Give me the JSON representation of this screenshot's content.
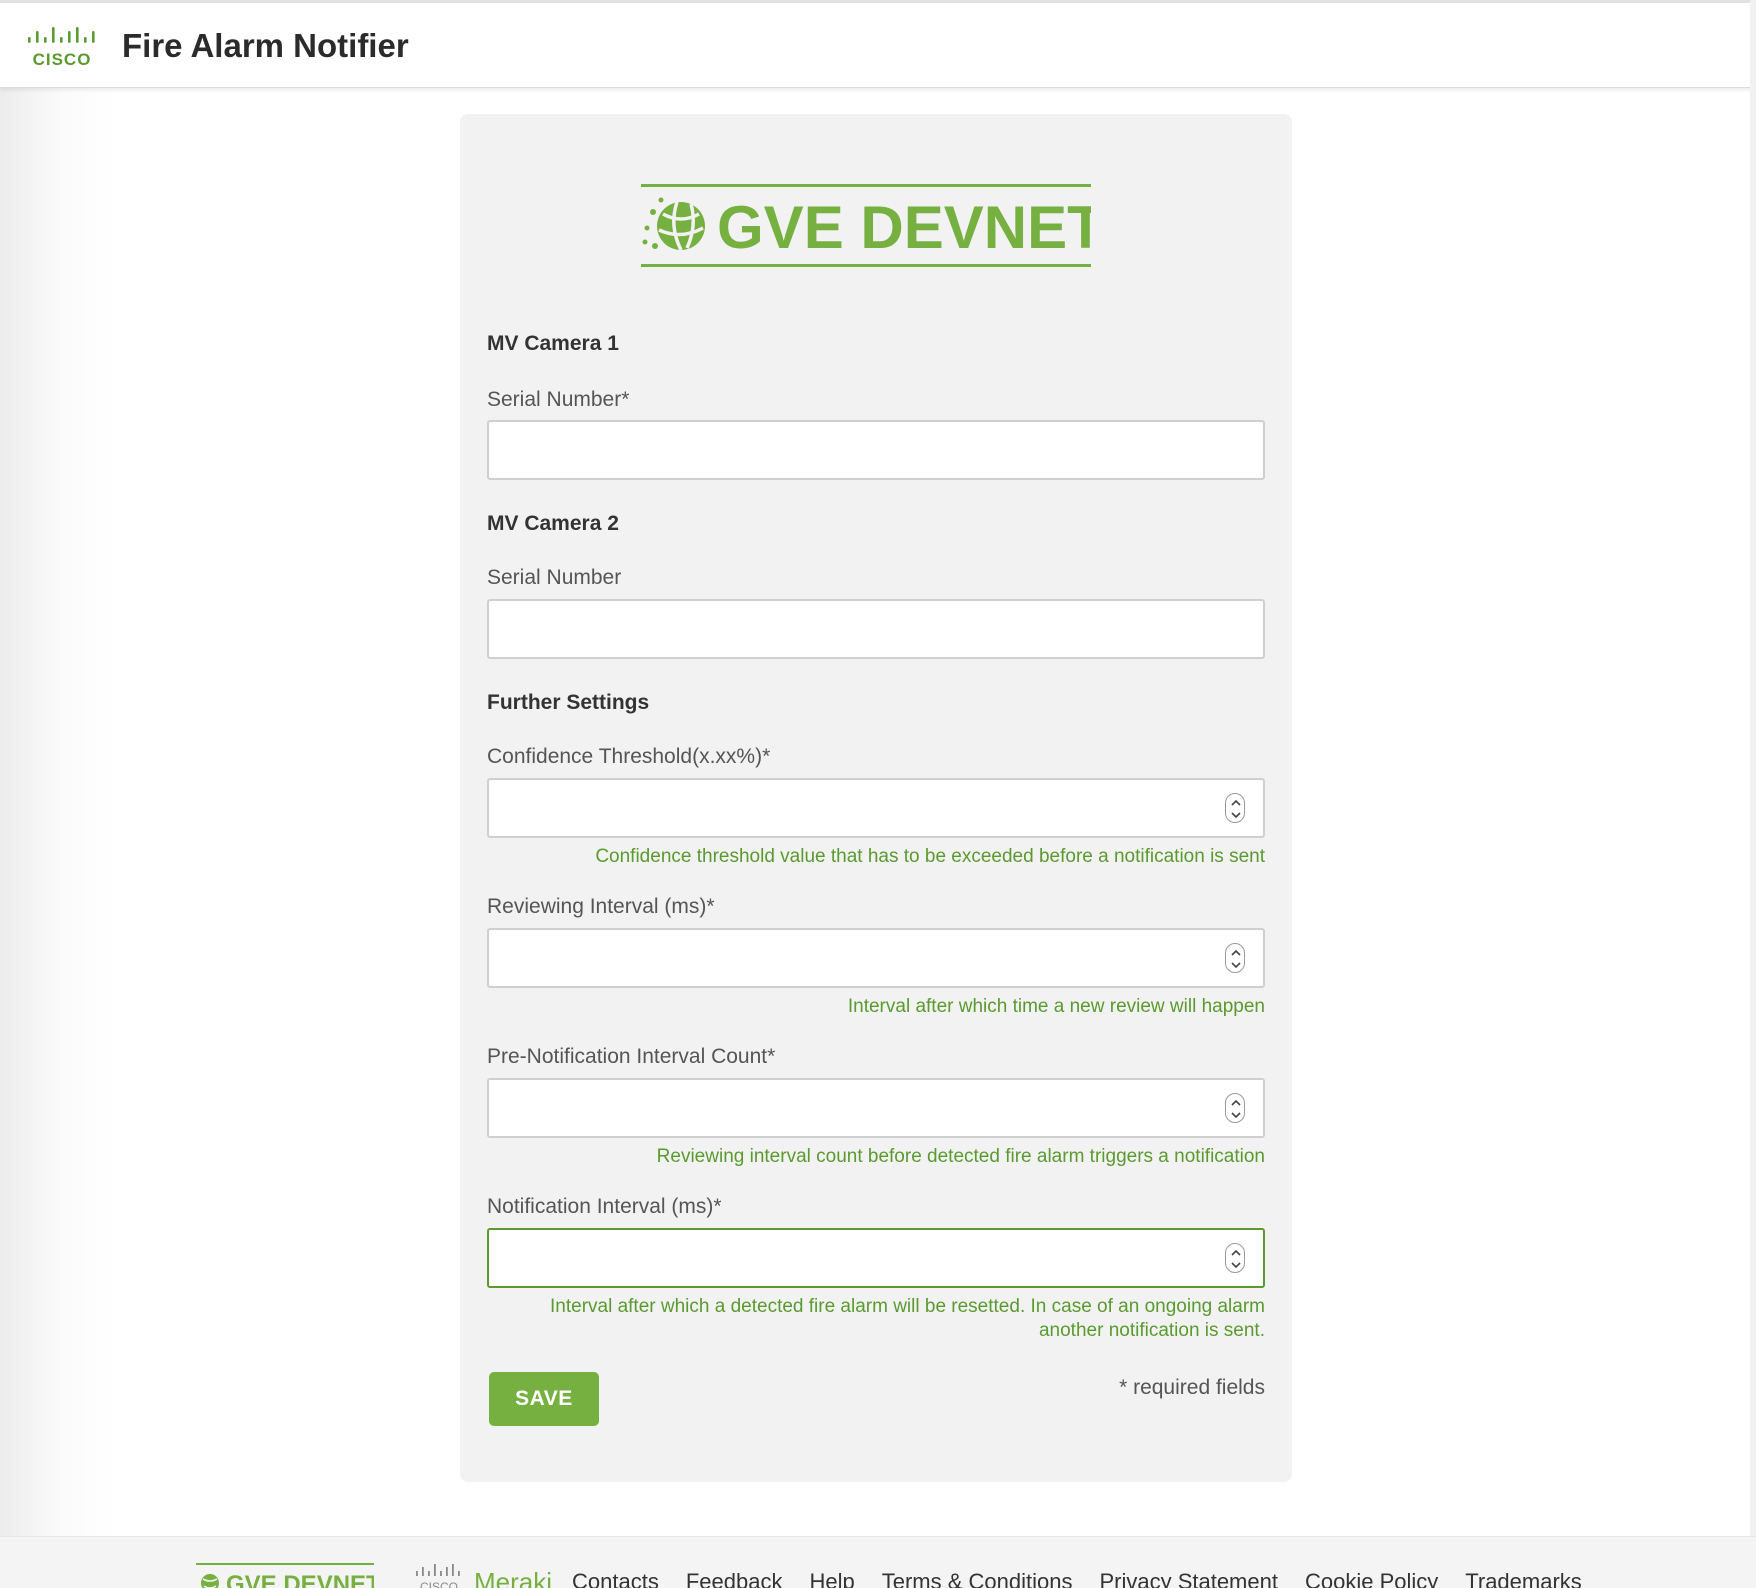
{
  "header": {
    "logo_icon": "cisco-logo",
    "logo_text": "CISCO",
    "title": "Fire Alarm Notifier"
  },
  "brand": {
    "logo_icon": "gve-devnet-logo",
    "text": "GVE DEVNET",
    "color": "#76b041"
  },
  "form": {
    "camera1": {
      "title": "MV Camera 1",
      "label": "Serial Number*",
      "value": ""
    },
    "camera2": {
      "title": "MV Camera 2",
      "label": "Serial Number",
      "value": ""
    },
    "settings": {
      "title": "Further Settings",
      "confidence": {
        "label": "Confidence Threshold(x.xx%)*",
        "value": "",
        "help": "Confidence threshold value that has to be exceeded before a notification is sent"
      },
      "reviewing": {
        "label": "Reviewing Interval (ms)*",
        "value": "",
        "help": "Interval after which time a new review will happen"
      },
      "pre_notification": {
        "label": "Pre-Notification Interval Count*",
        "value": "",
        "help": "Reviewing interval count before detected fire alarm triggers a notification"
      },
      "notification": {
        "label": "Notification Interval (ms)*",
        "value": "",
        "help_line1": "Interval after which a detected fire alarm will be resetted. In case of an ongoing alarm",
        "help_line2": "another notification is sent."
      }
    },
    "save_label": "SAVE",
    "required_note": "* required fields"
  },
  "footer": {
    "devnet_text": "GVE DEVNET",
    "cisco_text": "CISCO",
    "meraki_text": "Meraki",
    "links": [
      "Contacts",
      "Feedback",
      "Help",
      "Terms & Conditions",
      "Privacy Statement",
      "Cookie Policy",
      "Trademarks"
    ]
  },
  "colors": {
    "accent": "#76b041",
    "help_text": "#5a9a2f",
    "card_bg": "#f2f2f2"
  }
}
